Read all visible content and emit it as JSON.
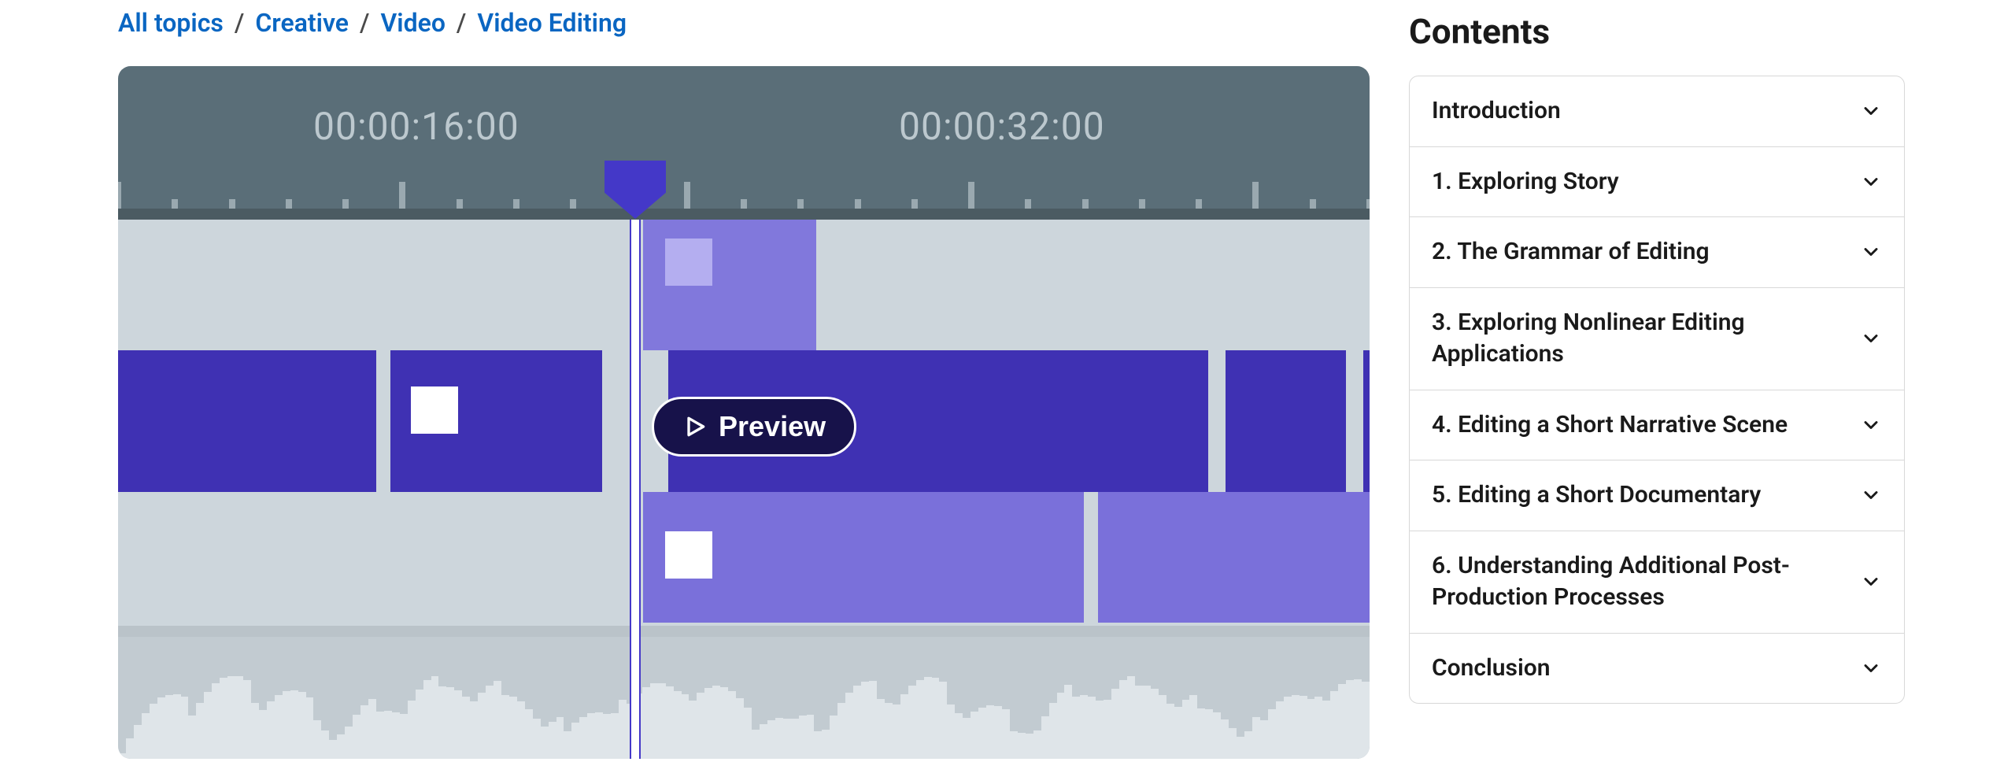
{
  "breadcrumb": {
    "items": [
      "All topics",
      "Creative",
      "Video",
      "Video Editing"
    ],
    "sep": "/"
  },
  "hero": {
    "timecodes": {
      "tc1": "00:00:16:00",
      "tc2": "00:00:32:00"
    },
    "preview_label": "Preview"
  },
  "contents": {
    "title": "Contents",
    "items": [
      {
        "label": "Introduction"
      },
      {
        "label": "1. Exploring Story"
      },
      {
        "label": "2. The Grammar of Editing"
      },
      {
        "label": "3. Exploring Nonlinear Editing Applications"
      },
      {
        "label": "4. Editing a Short Narrative Scene"
      },
      {
        "label": "5. Editing a Short Documentary"
      },
      {
        "label": "6. Understanding Additional Post-Production Processes"
      },
      {
        "label": "Conclusion"
      }
    ]
  }
}
